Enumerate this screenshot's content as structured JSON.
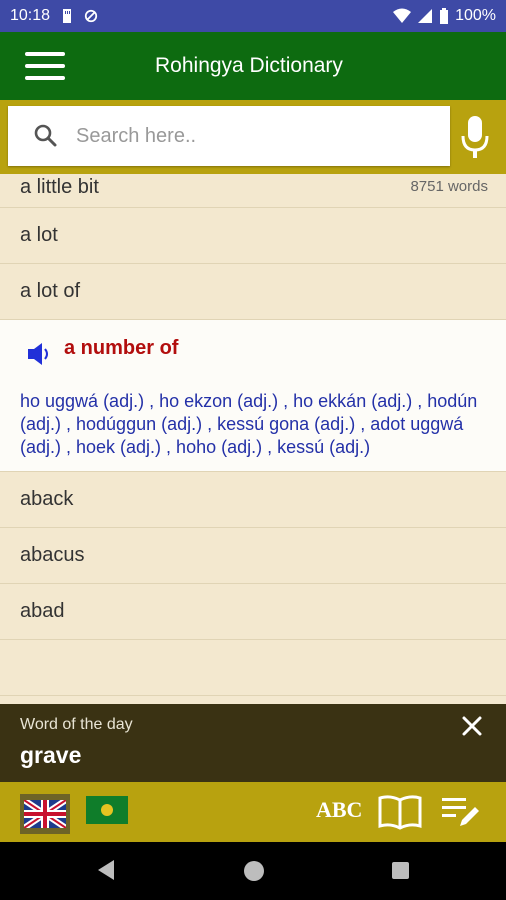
{
  "status": {
    "time": "10:18",
    "battery": "100%"
  },
  "app": {
    "title": "Rohingya Dictionary"
  },
  "search": {
    "placeholder": "Search here..",
    "value": ""
  },
  "list": {
    "count": "8751 words",
    "items_before": [
      {
        "word": "a little bit"
      },
      {
        "word": "a lot"
      },
      {
        "word": "a lot of"
      }
    ],
    "expanded": {
      "word": "a number of",
      "definition": "ho uggwá (adj.) , ho ekzon (adj.) , ho ekkán (adj.) , hodún (adj.) , hodúggun (adj.) , kessú gona (adj.) , adot uggwá (adj.) , hoek (adj.) , hoho (adj.) , kessú (adj.)"
    },
    "items_after": [
      {
        "word": "aback"
      },
      {
        "word": "abacus"
      },
      {
        "word": "abad"
      }
    ]
  },
  "word_of_day": {
    "label": "Word of the day",
    "word": "grave"
  },
  "bottom": {
    "abc_label": "ABC"
  },
  "colors": {
    "app_bar": "#0d6b10",
    "accent": "#b8a20f",
    "status_bar": "#3e4aa6",
    "wotd_bg": "#3a3213",
    "headword": "#b20e0e",
    "definition": "#2431a8"
  },
  "icons": [
    "menu-icon",
    "search-icon",
    "mic-icon",
    "speaker-icon",
    "close-icon",
    "uk-flag-icon",
    "rohingya-flag-icon",
    "book-icon",
    "edit-list-icon"
  ]
}
